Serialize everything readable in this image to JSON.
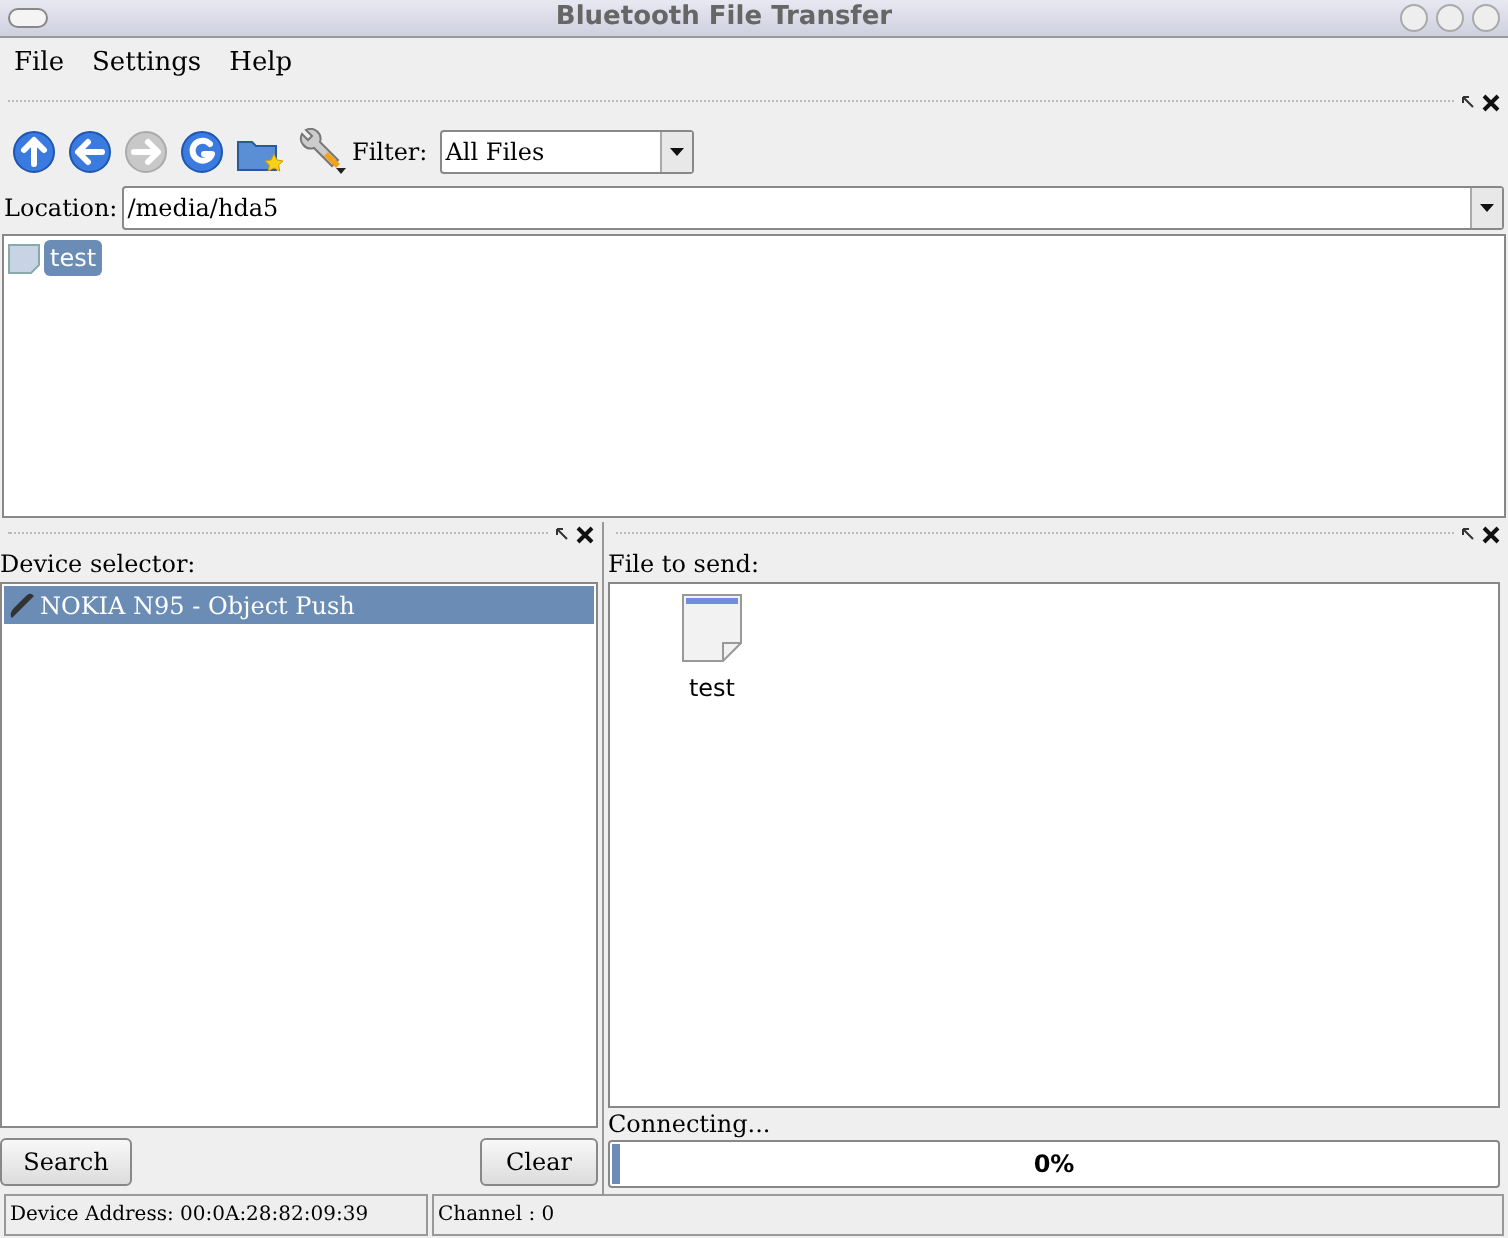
{
  "window": {
    "title": "Bluetooth File Transfer"
  },
  "menu": [
    "File",
    "Settings",
    "Help"
  ],
  "toolbar": [
    {
      "kind": "up",
      "disabled": false
    },
    {
      "kind": "back",
      "disabled": false
    },
    {
      "kind": "forward",
      "disabled": true
    },
    {
      "kind": "reload",
      "disabled": false
    },
    {
      "kind": "new-folder",
      "disabled": false
    },
    {
      "kind": "tools",
      "disabled": false
    }
  ],
  "filter": {
    "label": "Filter:",
    "value": "All Files"
  },
  "location": {
    "label": "Location:",
    "value": "/media/hda5"
  },
  "files": [
    {
      "name": "test",
      "selected": true
    }
  ],
  "device_pane": {
    "label": "Device selector:",
    "devices": [
      {
        "name": "NOKIA N95 -  Object Push",
        "selected": true
      }
    ]
  },
  "send_pane": {
    "label": "File to send:",
    "files": [
      {
        "name": "test"
      }
    ]
  },
  "buttons": [
    "Search",
    "Clear"
  ],
  "progress": {
    "label": "Connecting...",
    "level": 0.01,
    "reading": "0%"
  },
  "status_bar": [
    "Device Address: 00:0A:28:82:09:39",
    "Channel : 0"
  ]
}
